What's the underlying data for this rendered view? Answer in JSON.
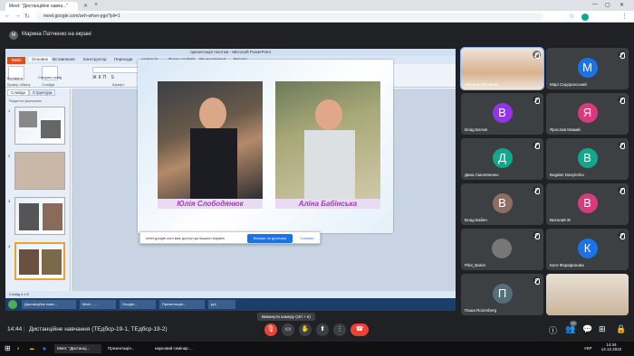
{
  "browser": {
    "tabs": [
      {
        "label": "Meet: \"Дистанційне навча...\""
      },
      {
        "label": "Meet - ...",
        "dot": true
      }
    ],
    "url": "meet.google.com/zeh-whvn-pgn?pli=1"
  },
  "meet": {
    "presenter_banner": "Марина Патченко на екрані",
    "presenter_initial": "М",
    "time": "14:44",
    "meeting_title": "Дистанційне навчання (ТЕдбср-19-1, ТЕдбср-19-2)",
    "tooltip": "Вимкнути камеру (ctrl + e)",
    "participant_count": "14"
  },
  "shared": {
    "ppt_title": "презентація пілотом - Microsoft PowerPoint",
    "file_tab": "Файл",
    "ribbon_tabs": [
      "Основне",
      "Вставлення",
      "Конструктор",
      "Переходи",
      "Анімація",
      "Показ слайдів",
      "Рецензування",
      "Вигляд"
    ],
    "group_labels": [
      "Буфер обміну",
      "Слайди",
      "Шрифт",
      "Абзац",
      "Креслення",
      "Редагування"
    ],
    "paste_label": "Вставити",
    "create_slide_label": "Створити слайд",
    "panel_tabs": [
      "Слайди",
      "Структура"
    ],
    "thumb_header": "Раздел по умолчанию",
    "caption1": "Юлія Слободянюк",
    "caption2": "Аліна Бабінська",
    "status": "Слайд 4 з 5",
    "notes_placeholder": "Нотатки до слайда",
    "toast_text": "meet.google.com має доступ до вашого екрана.",
    "toast_stop": "Більше не ділитися",
    "toast_hide": "Сховати",
    "inner_taskbar": [
      "Дистанційне навч...",
      "Meet - ...",
      "Google...",
      "Презентація...",
      "ppt"
    ],
    "ribbon_right": [
      "Знайти",
      "Замінити",
      "Виділити"
    ],
    "shape_fill": "Заливка фігури",
    "shape_outline": "Контур фігури",
    "shape_effects": "Ефекти фігур",
    "arrange": "Упорядкувати",
    "quick_styles": "Експрес-стилі"
  },
  "participants": [
    {
      "name": "Марина Патченко",
      "video": true,
      "color": "#c9a77c"
    },
    {
      "name": "Марі Сидорovський",
      "initial": "М",
      "color": "#1a73e8"
    },
    {
      "name": "Влад Белов",
      "initial": "В",
      "color": "#9334e6"
    },
    {
      "name": "Ярослав Мамай",
      "initial": "Я",
      "color": "#d93a7d"
    },
    {
      "name": "Дина Смоляненко",
      "initial": "Д",
      "color": "#12a88e"
    },
    {
      "name": "Bogdan Danylenko",
      "initial": "B",
      "color": "#12a88e"
    },
    {
      "name": "Влад Бабич",
      "initial": "В",
      "color": "#8d6e63"
    },
    {
      "name": "Виталий Ж",
      "initial": "В",
      "color": "#d93a7d"
    },
    {
      "name": "Pilot_Baton",
      "video": true,
      "color": "#555"
    },
    {
      "name": "Катя Фарафонова",
      "initial": "К",
      "color": "#1a73e8"
    },
    {
      "name": "Паша Rozenberg",
      "initial": "П",
      "color": "#546e7a"
    },
    {
      "name": "",
      "video": true,
      "color": "#d8c7b0"
    }
  ],
  "windows": {
    "taskbar": [
      "Meet: \"Дистанці...",
      "Презентація...",
      "науковий семінар ..."
    ],
    "lang": "УКР",
    "clock_time": "14:44",
    "clock_date": "14.12.2022"
  }
}
